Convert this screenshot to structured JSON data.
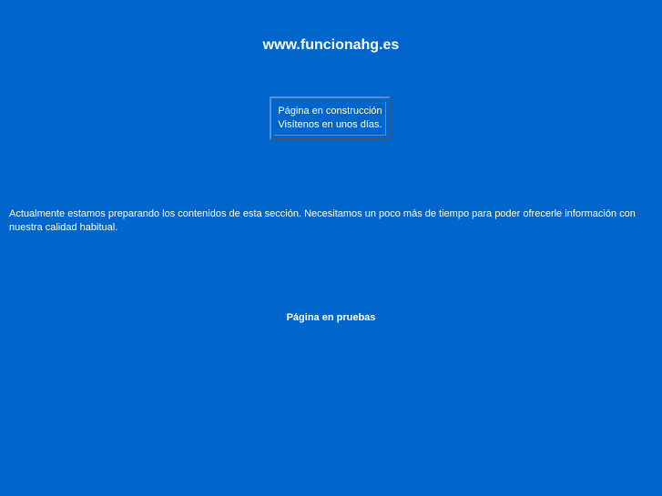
{
  "header": {
    "site_title": "www.funcionahg.es"
  },
  "notice": {
    "line1": "Página en construcción",
    "line2": "Visítenos en unos días."
  },
  "main": {
    "description": "Actualmente estamos preparando los contenidos de esta sección. Necesitamos un poco más de tiempo para poder ofrecerle información con nuestra calidad habitual."
  },
  "footer": {
    "status": "Página en pruebas"
  },
  "colors": {
    "background": "#0066cc",
    "text": "#ffffff",
    "border": "#5a8ed8"
  }
}
